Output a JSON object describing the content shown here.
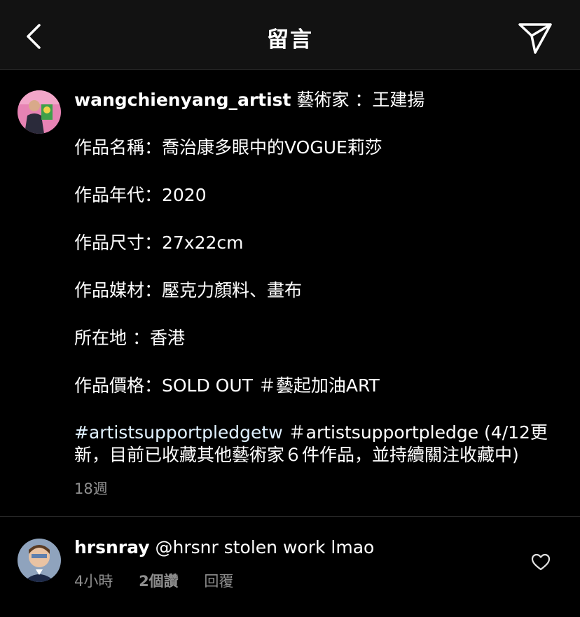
{
  "header": {
    "title": "留言",
    "back_icon": "chevron-left-icon",
    "share_icon": "paper-plane-icon"
  },
  "post": {
    "username": "wangchienyang_artist",
    "first_line": " 藝術家 ：王建揚",
    "lines": [
      "作品名稱：喬治康多眼中的VOGUE莉莎",
      "作品年代：2020",
      "作品尺寸：27x22cm",
      "作品媒材：壓克力顏料、畫布",
      "所在地 ：香港",
      "作品價格：SOLD OUT ＃藝起加油ART"
    ],
    "hashtag": "#artistsupportpledgetw",
    "last_text": " ＃artistsupportpledge (4/12更新，目前已收藏其他藝術家６件作品，並持續關注收藏中)",
    "time": "18週"
  },
  "comment": {
    "username": "hrsnray",
    "text": " @hrsnr stolen work lmao",
    "time": "4小時",
    "likes": "2個讚",
    "reply": "回覆",
    "like_icon": "heart-outline-icon"
  }
}
